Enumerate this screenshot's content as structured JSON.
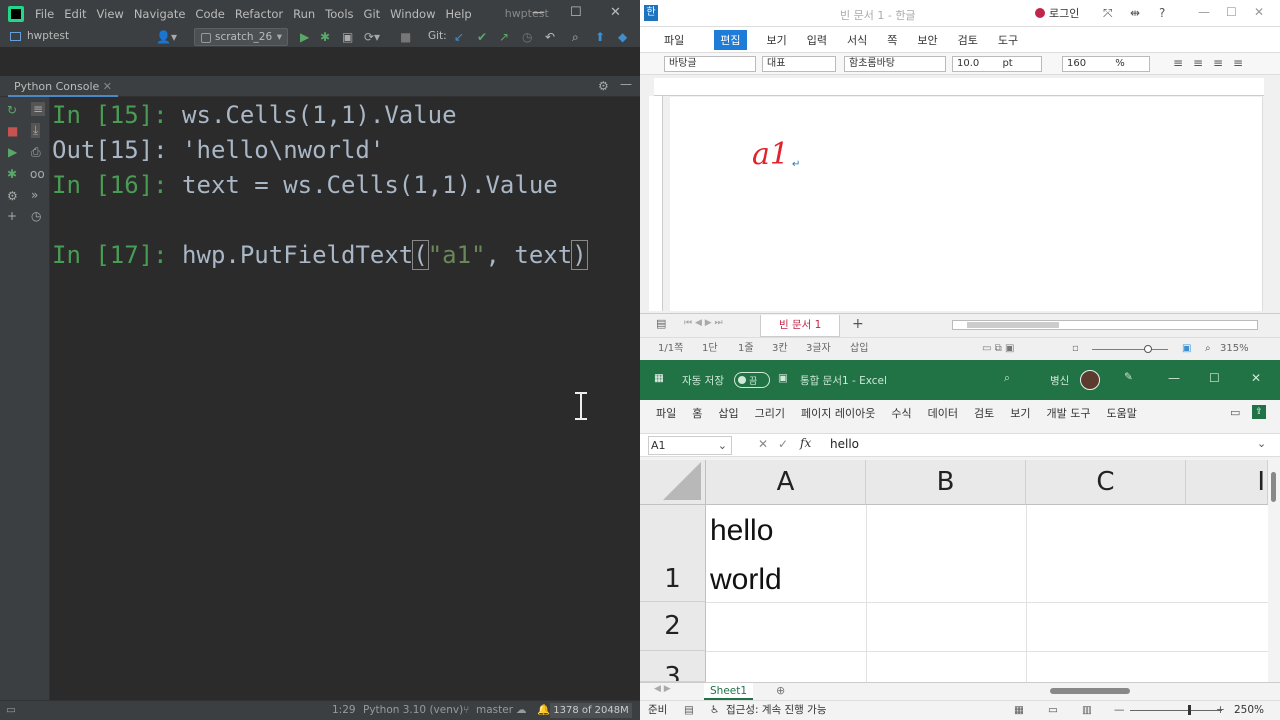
{
  "pycharm": {
    "menu": [
      "File",
      "Edit",
      "View",
      "Navigate",
      "Code",
      "Refactor",
      "Run",
      "Tools",
      "Git",
      "Window",
      "Help"
    ],
    "window_title": "hwptest",
    "project": "hwptest",
    "run_config": "scratch_26",
    "git_label": "Git:",
    "tool_tab": "Python Console",
    "console": {
      "l1_prompt": "In [15]:",
      "l1_code": " ws.Cells(1,1).Value",
      "l2_prompt": "Out[15]:",
      "l2_code": " 'hello\\nworld'",
      "l3_prompt": "In [16]:",
      "l3_code": " text = ws.Cells(1,1).Value",
      "l4_prompt": "In [17]:",
      "l4_pre": " hwp.PutFieldText",
      "l4_open": "(",
      "l4_str": "\"a1\"",
      "l4_mid": ", text",
      "l4_close": ")"
    },
    "status": {
      "position": "1:29",
      "interpreter": "Python 3.10 (venv)",
      "branch": "master",
      "memory": "1378 of 2048M"
    }
  },
  "hwp": {
    "doc_title": "빈 문서 1 - 한글",
    "login": "로그인",
    "menu": [
      "파일",
      "편집",
      "보기",
      "입력",
      "서식",
      "쪽",
      "보안",
      "검토",
      "도구"
    ],
    "style": "바탕글",
    "lang": "대표",
    "font": "함초롬바탕",
    "size": "10.0",
    "size_unit": "pt",
    "spacing": "160",
    "spacing_unit": "%",
    "field_text": "a1",
    "doc_tab": "빈 문서 1",
    "status": {
      "page": "1/1쪽",
      "section": "1단",
      "line": "1줄",
      "col": "3칸",
      "chars": "3글자",
      "mode": "삽입",
      "zoom": "315%"
    }
  },
  "excel": {
    "autosave": "자동 저장",
    "autosave_state": "끔",
    "doc_title": "통합 문서1 - Excel",
    "user": "병신",
    "ribbon": [
      "파일",
      "홈",
      "삽입",
      "그리기",
      "페이지 레이아웃",
      "수식",
      "데이터",
      "검토",
      "보기",
      "개발 도구",
      "도움말"
    ],
    "name_box": "A1",
    "formula": "hello",
    "columns": [
      "A",
      "B",
      "C",
      "I"
    ],
    "rows": [
      "1",
      "2",
      "3"
    ],
    "cell_a1": "hello\nworld",
    "sheet": "Sheet1",
    "status_ready": "준비",
    "accessibility": "접근성: 계속 진행 가능",
    "zoom": "250%"
  }
}
